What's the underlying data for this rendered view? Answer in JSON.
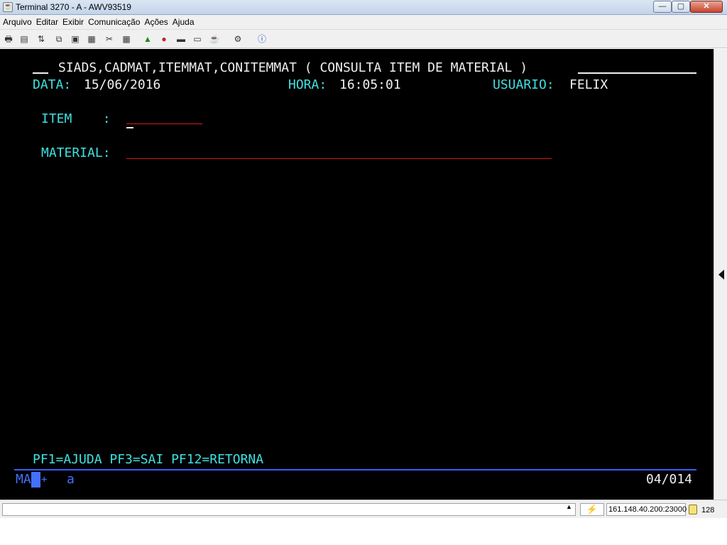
{
  "window": {
    "title": "Terminal 3270 - A - AWV93519",
    "controls": {
      "minimize": "—",
      "maximize": "▢",
      "close": "✕"
    }
  },
  "menu": [
    "Arquivo",
    "Editar",
    "Exibir",
    "Comunicação",
    "Ações",
    "Ajuda"
  ],
  "toolbar": {
    "icons": [
      "print-icon",
      "print-screen-icon",
      "transfer-icon",
      "copy-icon",
      "paste-icon",
      "paste-special-icon",
      "macro-icon",
      "keypad-icon",
      "record-icon",
      "stop-icon",
      "play-icon",
      "keyboard-icon",
      "tools-icon",
      "help-icon"
    ]
  },
  "screen": {
    "title": "SIADS,CADMAT,ITEMMAT,CONITEMMAT ( CONSULTA ITEM DE MATERIAL )",
    "data_label": "DATA:",
    "data_value": "15/06/2016",
    "hora_label": "HORA:",
    "hora_value": "16:05:01",
    "usuario_label": "USUARIO:",
    "usuario_value": "FELIX",
    "item_label": "ITEM    :",
    "material_label": "MATERIAL:",
    "pf_keys": "PF1=AJUDA PF3=SAI PF12=RETORNA",
    "oia_mode_left": "MA",
    "oia_mode_right": "+",
    "oia_input": "a",
    "oia_cursor_pos": "04/014"
  },
  "status": {
    "host": "161.148.40.200:23000",
    "number": "128"
  },
  "colors": {
    "terminal_bg": "#000000",
    "terminal_cyan": "#40e0e0",
    "terminal_white": "#f0f0f0",
    "field_underline": "#d81b1b",
    "oia_line": "#3060ff"
  }
}
